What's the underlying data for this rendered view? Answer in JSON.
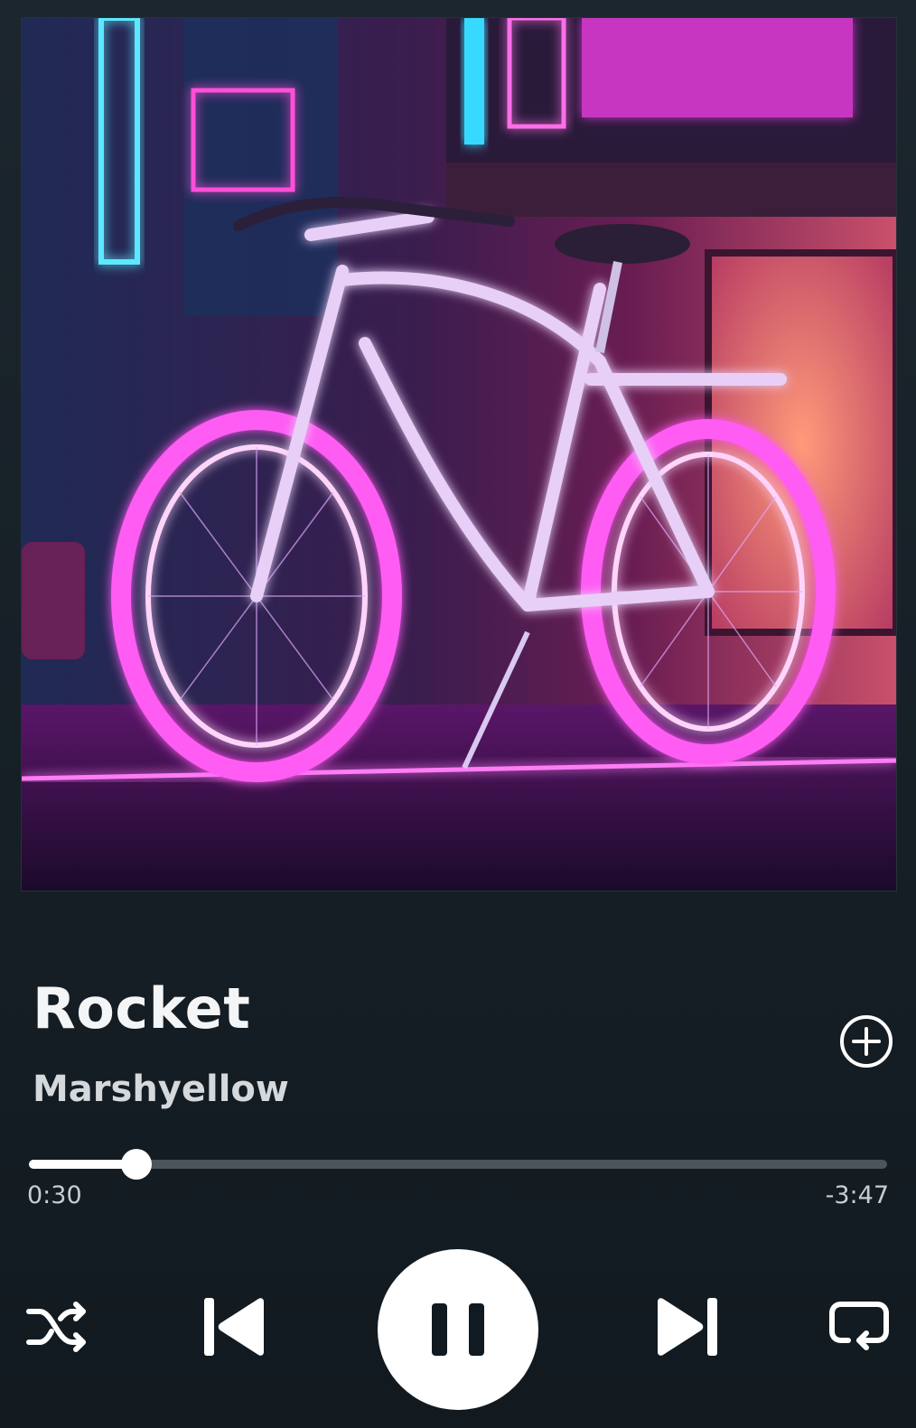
{
  "track": {
    "title": "Rocket",
    "artist": "Marshyellow"
  },
  "playback": {
    "elapsed": "0:30",
    "remaining": "-3:47",
    "progress_fraction": 0.125,
    "state": "playing"
  },
  "icons": {
    "add": "plus-circle-icon",
    "shuffle": "shuffle-icon",
    "previous": "skip-previous-icon",
    "pause": "pause-icon",
    "next": "skip-next-icon",
    "repeat": "repeat-icon"
  },
  "colors": {
    "background": "#151e25",
    "accent": "#ffffff",
    "track": "#4d555c",
    "neon_pink": "#ff3df5",
    "neon_cyan": "#34e3ff"
  }
}
